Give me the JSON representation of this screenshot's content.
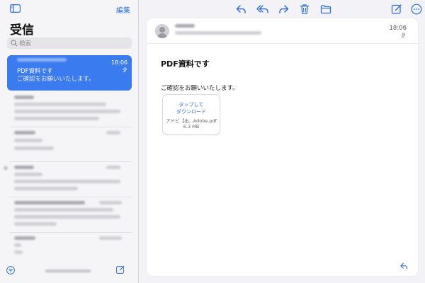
{
  "sidebar": {
    "edit_label": "編集",
    "title": "受信",
    "search_placeholder": "検索",
    "selected_mail": {
      "subject": "PDF資料です",
      "preview": "ご確認をお願いいたします。",
      "time": "18:06"
    }
  },
  "message": {
    "time": "18:06",
    "subject": "PDF資料です",
    "body": "ご確認をお願いいたします。",
    "attachment": {
      "line1": "タップして",
      "line2": "ダウンロード",
      "filename": "アドビ【出...Adobe.pdf",
      "size": "6.3 MB"
    }
  },
  "colors": {
    "accent": "#2f6fe0",
    "selected_row": "#3a7bf0"
  },
  "icons": {
    "toolbar": [
      "reply-icon",
      "reply-all-icon",
      "forward-icon",
      "trash-icon",
      "folder-icon",
      "compose-icon",
      "more-icon"
    ]
  }
}
